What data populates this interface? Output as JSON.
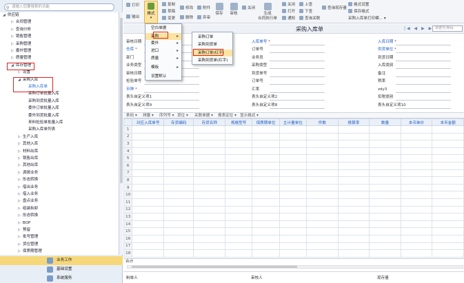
{
  "left": {
    "search_placeholder": "请输入您要搜索的功能",
    "tree": [
      {
        "label": "供应链",
        "arrow": "◢"
      },
      {
        "label": "合同管理",
        "arrow": "▷"
      },
      {
        "label": "查询分析",
        "arrow": "▷"
      },
      {
        "label": "销售管理",
        "arrow": "▷"
      },
      {
        "label": "采购管理",
        "arrow": "▷"
      },
      {
        "label": "委外管理",
        "arrow": "▷"
      },
      {
        "label": "质量管理",
        "arrow": "▷"
      },
      {
        "label": "库存管理",
        "arrow": "◢"
      },
      {
        "label": "设置",
        "arrow": "▷"
      },
      {
        "label": "采购入库",
        "arrow": "◢"
      },
      {
        "label": "采购入库单",
        "arrow": ""
      },
      {
        "label": "采购订单批量入库",
        "arrow": ""
      },
      {
        "label": "采购到货批量入库",
        "arrow": ""
      },
      {
        "label": "委外订单批量入库",
        "arrow": ""
      },
      {
        "label": "委外到货批量入库",
        "arrow": ""
      },
      {
        "label": "来料检验单批量入库",
        "arrow": ""
      },
      {
        "label": "采购入库单列表",
        "arrow": ""
      },
      {
        "label": "生产入库",
        "arrow": "▷"
      },
      {
        "label": "其他入库",
        "arrow": "▷"
      },
      {
        "label": "材料出库",
        "arrow": "▷"
      },
      {
        "label": "销售出库",
        "arrow": "▷"
      },
      {
        "label": "其他出库",
        "arrow": "▷"
      },
      {
        "label": "调拨业务",
        "arrow": "▷"
      },
      {
        "label": "形态转换",
        "arrow": "▷"
      },
      {
        "label": "借出业务",
        "arrow": "▷"
      },
      {
        "label": "借入业务",
        "arrow": "▷"
      },
      {
        "label": "盘点业务",
        "arrow": "▷"
      },
      {
        "label": "组装拆卸",
        "arrow": "▷"
      },
      {
        "label": "形态转换",
        "arrow": "▷"
      },
      {
        "label": "BOP",
        "arrow": "▷"
      },
      {
        "label": "预留",
        "arrow": "▷"
      },
      {
        "label": "批号管理",
        "arrow": "▷"
      },
      {
        "label": "货位管理",
        "arrow": "▷"
      },
      {
        "label": "保质期管理",
        "arrow": "▷"
      }
    ],
    "bottom": [
      {
        "label": "业务工作",
        "active": true
      },
      {
        "label": "基础设置",
        "active": false
      },
      {
        "label": "系统服务",
        "active": false
      }
    ]
  },
  "toolbar": {
    "print": "打印",
    "output": "输出",
    "copy": "复制",
    "draft": "草稿",
    "change": "变更",
    "modify": "修改",
    "attach": "附件",
    "delete": "删除",
    "abandon": "弃审",
    "save": "保存",
    "audit": "审核",
    "push": "推式",
    "generate": "生成",
    "generate_sub": "合同执行单",
    "close": "关闭",
    "open": "打开",
    "notify": "通知",
    "up": "上查",
    "down": "下查",
    "links": "查询关联",
    "query_stock": "查询现存量",
    "format_set": "格式设置",
    "save_format": "保存格式",
    "template_name": "采购入库单打印模..."
  },
  "menu": {
    "blank": "空白单据",
    "purchase": "采购",
    "outsource": "委外",
    "import": "进口",
    "quality": "质量",
    "template": "模板",
    "set_default": "设置默认",
    "sub": [
      "采购订单",
      "采购到货单",
      "采购订单(红字)",
      "采购到货单(红字)"
    ]
  },
  "form": {
    "title": "采购入库单",
    "nav": "|◀ ◀ ▶ ▶|",
    "search_placeholder": "单据号/条码",
    "labels": {
      "audit_date": "审核日期",
      "in_no": "入库单号",
      "in_date": "入库日期",
      "warehouse": "仓库",
      "order_no": "订单号",
      "arrival_no": "到货单号",
      "supplier": "供货单位",
      "dept": "部门",
      "operator": "业务员",
      "arrival_date": "到货日期",
      "biz_type": "业务类型",
      "purch_type": "采购类型",
      "in_type": "入库类别",
      "audit_date2": "审核日期",
      "check_no": "检验单号",
      "remark": "备注",
      "fx": "来源",
      "stock_no": "订单号",
      "tax": "税率",
      "currency": "币种",
      "rate": "汇率",
      "exch": "zdy3",
      "custom1": "表头自定义项1",
      "custom2": "表头自定义项2",
      "kind": "扣税类别",
      "custom9": "表头自定义项9",
      "custom8": "表头自定义项8",
      "custom10": "表头自定义项10"
    }
  },
  "grid": {
    "tools": [
      "条码",
      "排量",
      "序列号",
      "货位",
      "关联单据",
      "报表定位",
      "显示格式"
    ],
    "headers": [
      "",
      "对应入库单号",
      "存货编码",
      "存货名称",
      "规格型号",
      "保质期单位",
      "主计量单位",
      "件数",
      "换算率",
      "数量",
      "本币单价",
      "本币金额"
    ],
    "rows": [
      "1",
      "2",
      "3",
      "4",
      "5",
      "6",
      "7",
      "8",
      "9",
      "10",
      "11",
      "12",
      "13",
      "14",
      "15",
      "16",
      "17",
      "18"
    ],
    "sum_label": "合计"
  },
  "footer": {
    "maker": "制单人",
    "auditor": "审核人",
    "stock_keeper": "现存量"
  }
}
